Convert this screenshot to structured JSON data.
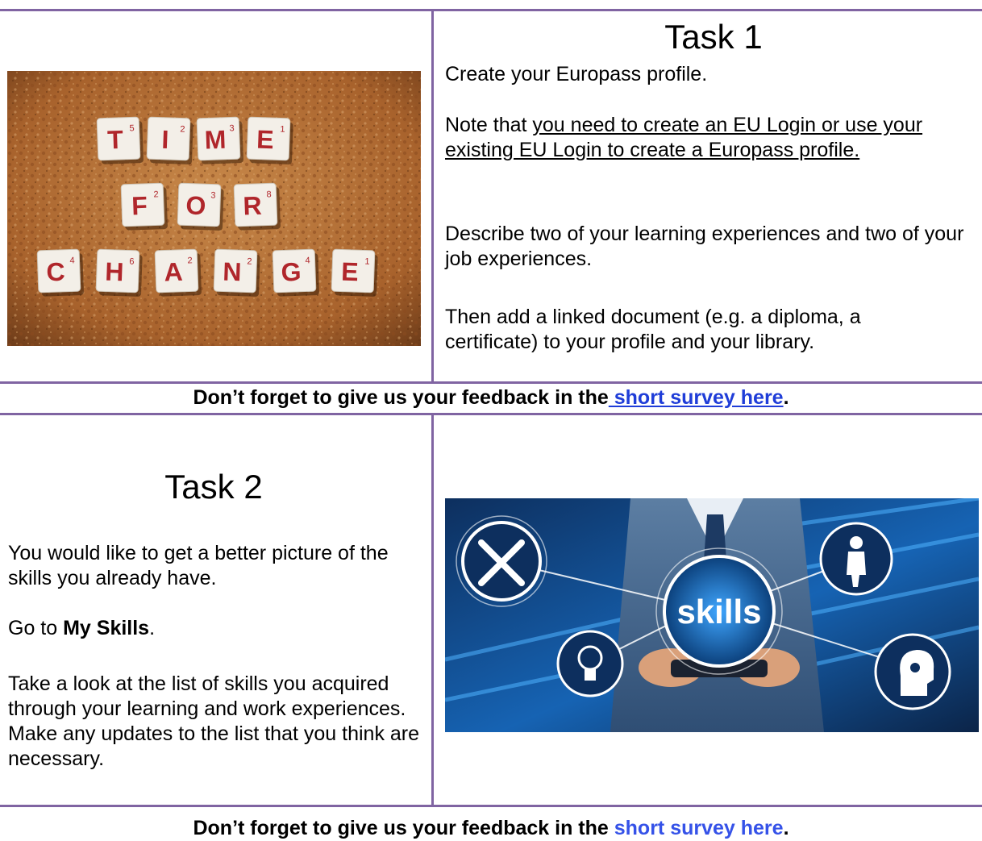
{
  "task1": {
    "title": "Task 1",
    "intro": "Create your Europass profile.",
    "note_prefix": "Note that ",
    "note_underlined": "you need to create an EU Login or use your existing EU Login to create a Europass profile.",
    "describe": "Describe two of your learning experiences and two of your job experiences.",
    "linked": "Then add a linked document (e.g. a diploma, a certificate) to your profile and your library.",
    "image": {
      "tile_rows": [
        [
          {
            "l": "T",
            "n": "5"
          },
          {
            "l": "I",
            "n": "2"
          },
          {
            "l": "M",
            "n": "3"
          },
          {
            "l": "E",
            "n": "1"
          }
        ],
        [
          {
            "l": "F",
            "n": "2"
          },
          {
            "l": "O",
            "n": "3"
          },
          {
            "l": "R",
            "n": "8"
          }
        ],
        [
          {
            "l": "C",
            "n": "4"
          },
          {
            "l": "H",
            "n": "6"
          },
          {
            "l": "A",
            "n": "2"
          },
          {
            "l": "N",
            "n": "2"
          },
          {
            "l": "G",
            "n": "4"
          },
          {
            "l": "E",
            "n": "1"
          }
        ]
      ]
    }
  },
  "feedback1": {
    "prefix": "Don’t forget to give us your feedback in the",
    "link": " short survey here",
    "suffix": "."
  },
  "task2": {
    "title": "Task 2",
    "intro": "You would like to get a better picture of the skills you already have.",
    "goto_prefix": "Go to ",
    "goto_bold": "My Skills",
    "goto_suffix": ".",
    "instructions": "Take a look at the list of skills you acquired through your learning and work experiences. Make any updates to the list that you think are necessary.",
    "image": {
      "center_word": "skills"
    }
  },
  "feedback2": {
    "prefix": "Don’t forget to give us your feedback in the ",
    "link": "short survey here",
    "suffix": "."
  },
  "colors": {
    "rule": "#8064a2",
    "link": "#1f3dd8"
  }
}
